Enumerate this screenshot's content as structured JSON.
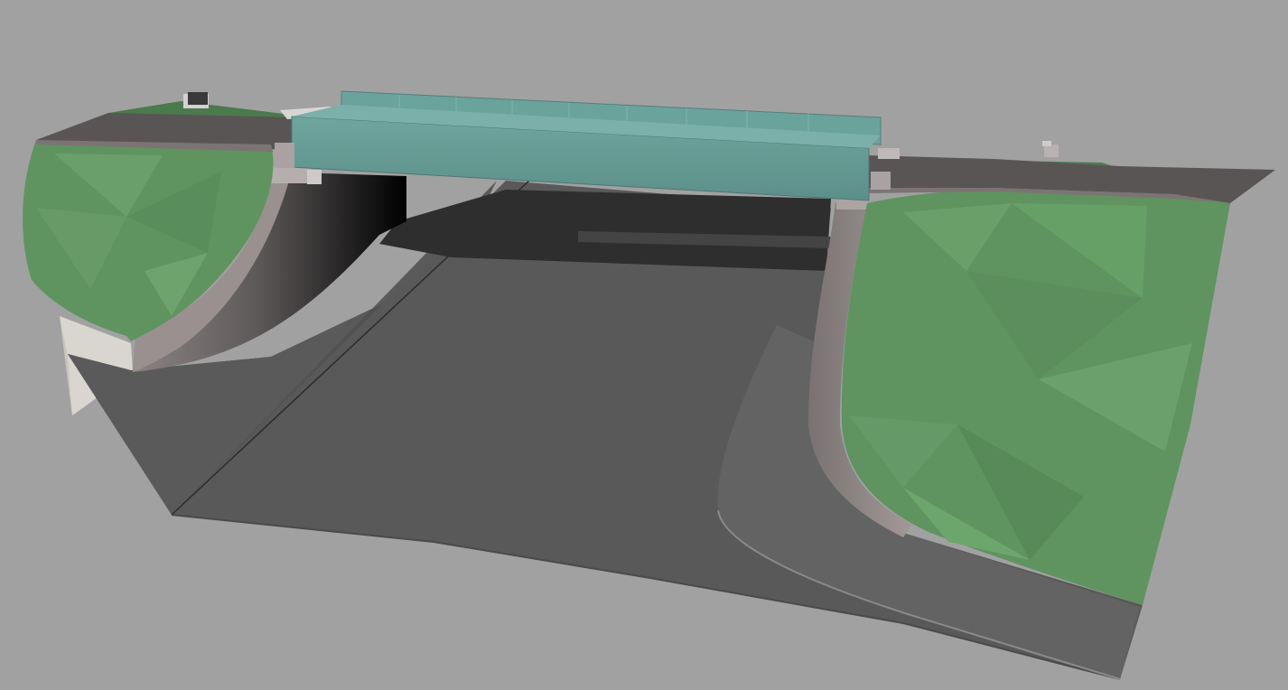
{
  "viewer": {
    "background_color": "#a1a1a1"
  },
  "scene": {
    "bridge_deck_color": "#669a94",
    "grass_color": "#5f9460",
    "road_color": "#5d5d5d",
    "concrete_color": "#9b9191",
    "parts": [
      "left-embankment",
      "right-embankment",
      "underpass-road",
      "left-abutment-wall",
      "right-abutment-wall",
      "bridge-girder",
      "top-road-left",
      "top-road-right",
      "abutment-shadow"
    ]
  }
}
